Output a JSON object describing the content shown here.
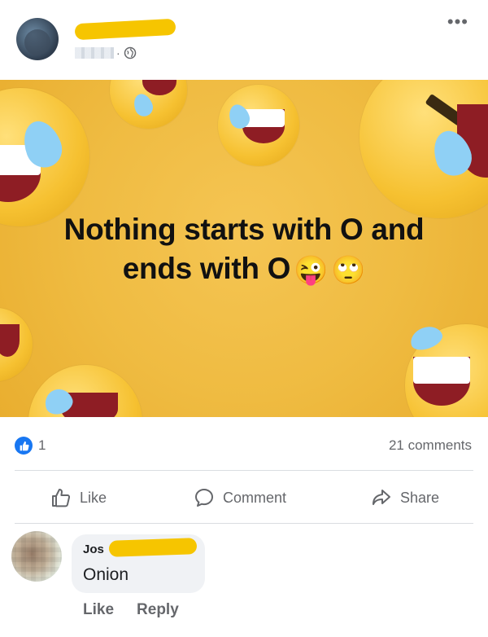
{
  "post": {
    "author_name": "",
    "menu_glyph": "•••",
    "meta_separator": "·",
    "privacy_icon": "globe-icon"
  },
  "image": {
    "caption_line1": "Nothing starts with O and",
    "caption_line2": "ends with O",
    "caption_emoji1": "😜",
    "caption_emoji2": "🙄",
    "background_color": "#efbb41"
  },
  "stats": {
    "like_count": "1",
    "comments_label": "21 comments",
    "like_badge_color": "#1877f2"
  },
  "actions": {
    "like_label": "Like",
    "comment_label": "Comment",
    "share_label": "Share"
  },
  "comment": {
    "author_name": "Jos",
    "text": "Onion",
    "like_label": "Like",
    "reply_label": "Reply"
  }
}
